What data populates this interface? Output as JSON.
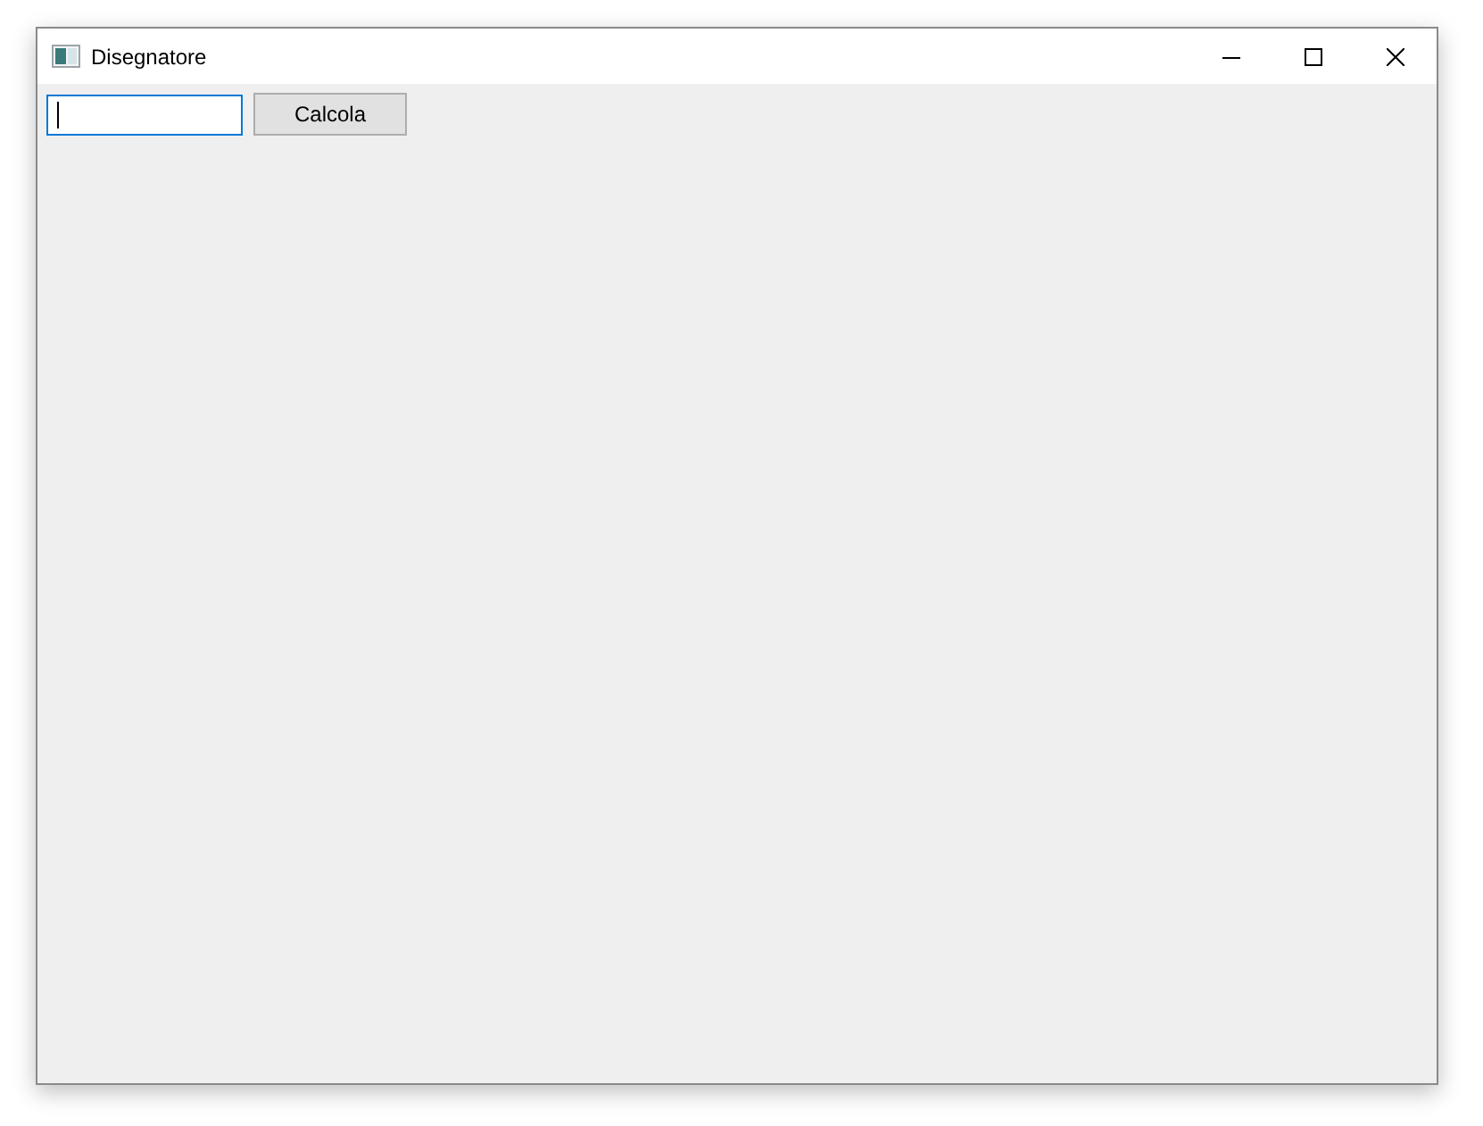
{
  "window": {
    "title": "Disegnatore"
  },
  "input": {
    "focused": true
  },
  "button": {
    "label": "Calcola"
  }
}
